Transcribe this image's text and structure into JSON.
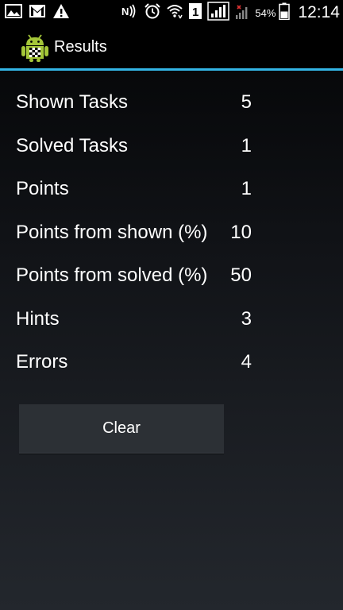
{
  "status_bar": {
    "left_icons": [
      "image-icon",
      "gmail-icon",
      "warning-icon"
    ],
    "right_icons": [
      "nfc-icon",
      "alarm-icon",
      "wifi-icon",
      "sim-1-icon",
      "signal-icon",
      "signal-no-service-icon",
      "battery-icon"
    ],
    "battery_percent": "54%",
    "time": "12:14"
  },
  "action_bar": {
    "icon": "android-app-icon",
    "title": "Results",
    "accent_color": "#33b5e5"
  },
  "stats": [
    {
      "label": "Shown Tasks",
      "value": "5"
    },
    {
      "label": "Solved Tasks",
      "value": "1"
    },
    {
      "label": "Points",
      "value": "1"
    },
    {
      "label": "Points from shown (%)",
      "value": "10"
    },
    {
      "label": "Points from solved (%)",
      "value": "50"
    },
    {
      "label": "Hints",
      "value": "3"
    },
    {
      "label": "Errors",
      "value": "4"
    }
  ],
  "clear_button": {
    "label": "Clear"
  }
}
